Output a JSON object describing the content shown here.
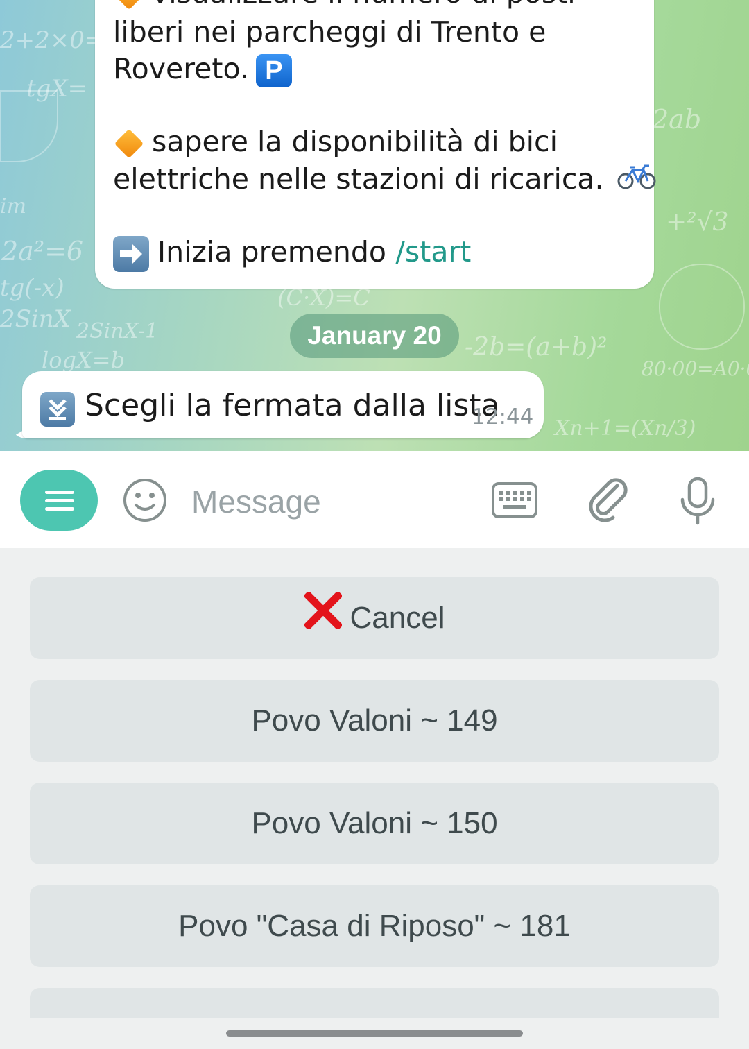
{
  "chat": {
    "intro_lines": [
      "visualizzare il numero di posti",
      "liberi nei parcheggi di Trento e",
      "Rovereto.",
      "sapere la disponibilità di bici",
      "elettriche nelle stazioni di ricarica.",
      "Inizia premendo"
    ],
    "start_command": "/start",
    "date_separator": "January 20",
    "last_message": {
      "text": "Scegli la fermata dalla lista",
      "time": "12:44"
    }
  },
  "input": {
    "placeholder": "Message"
  },
  "bot_keyboard": {
    "buttons": [
      "Cancel",
      "Povo Valoni ~ 149",
      "Povo Valoni ~ 150",
      "Povo \"Casa di Riposo\" ~ 181"
    ]
  },
  "colors": {
    "accent": "#4dc6b1",
    "link": "#22998a",
    "button_bg": "#e0e5e6",
    "cancel_red": "#e3141b"
  }
}
